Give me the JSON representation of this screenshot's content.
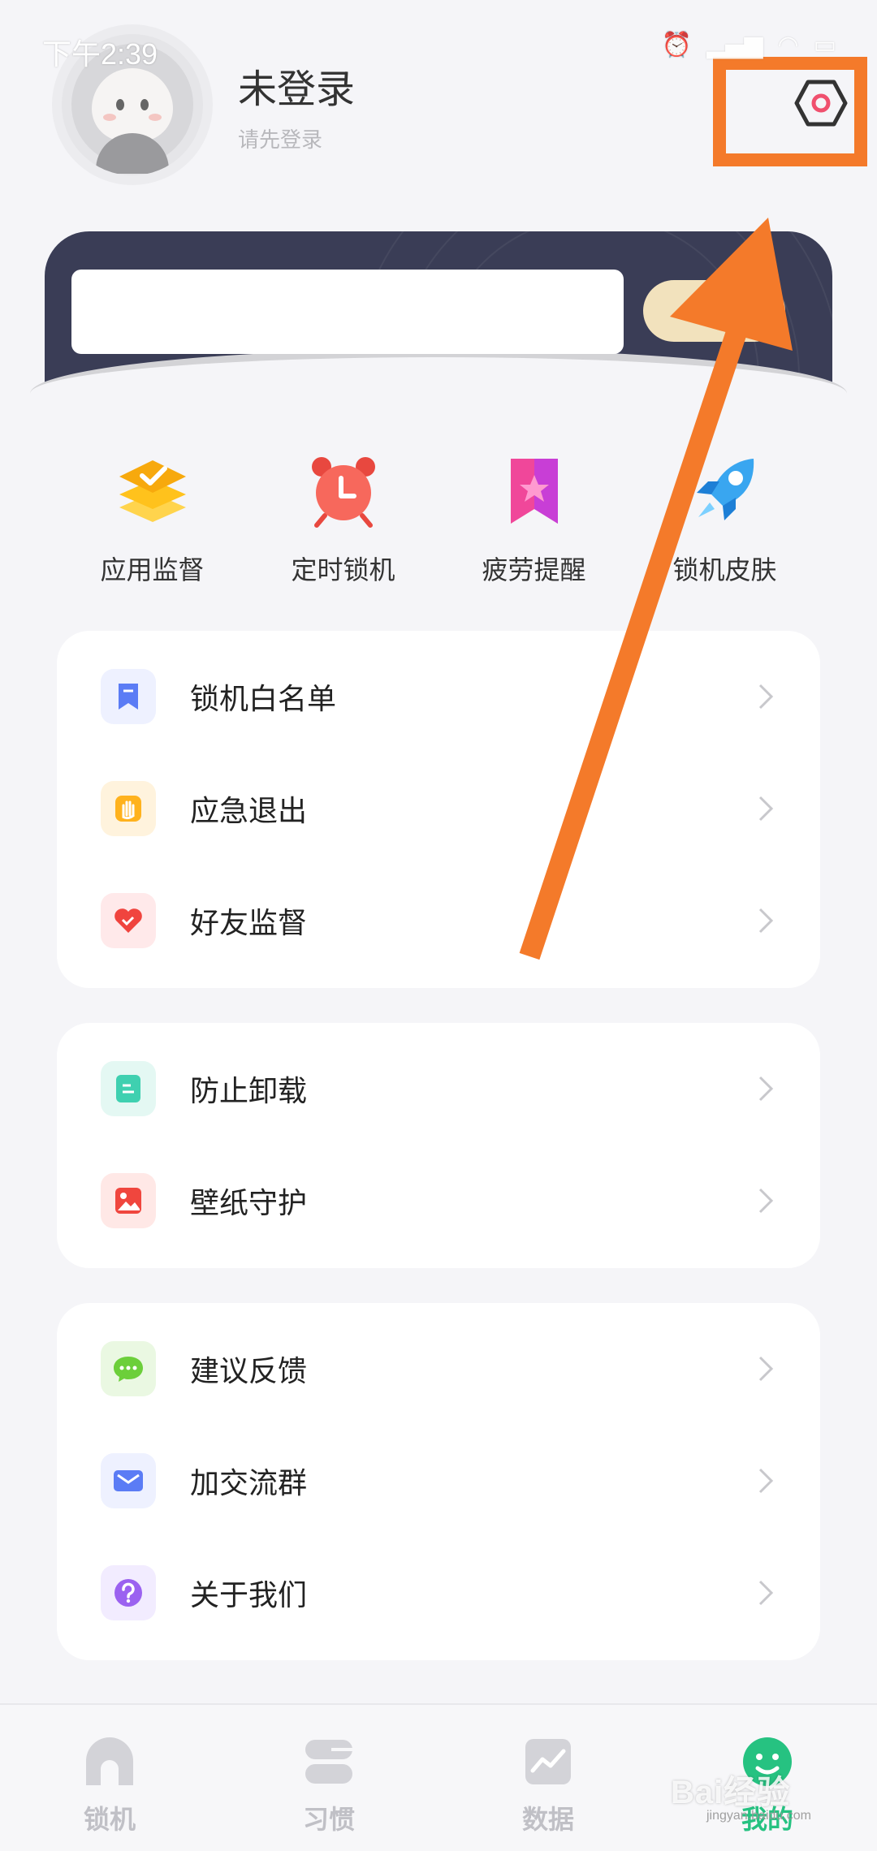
{
  "status_bar": {
    "time": "下午2:39"
  },
  "profile": {
    "username": "未登录",
    "login_hint": "请先登录"
  },
  "shortcuts": [
    {
      "label": "应用监督",
      "icon": "layers-check-icon"
    },
    {
      "label": "定时锁机",
      "icon": "alarm-clock-icon"
    },
    {
      "label": "疲劳提醒",
      "icon": "bookmark-star-icon"
    },
    {
      "label": "锁机皮肤",
      "icon": "rocket-icon"
    }
  ],
  "card1": [
    {
      "label": "锁机白名单",
      "icon": "bookmark-icon"
    },
    {
      "label": "应急退出",
      "icon": "hand-icon"
    },
    {
      "label": "好友监督",
      "icon": "heart-icon"
    }
  ],
  "card2": [
    {
      "label": "防止卸载",
      "icon": "document-icon"
    },
    {
      "label": "壁纸守护",
      "icon": "image-icon"
    }
  ],
  "card3": [
    {
      "label": "建议反馈",
      "icon": "chat-icon"
    },
    {
      "label": "加交流群",
      "icon": "mail-icon"
    },
    {
      "label": "关于我们",
      "icon": "question-icon"
    }
  ],
  "bottom_nav": [
    {
      "label": "锁机",
      "icon": "lock-nav-icon",
      "active": false
    },
    {
      "label": "习惯",
      "icon": "habit-nav-icon",
      "active": false
    },
    {
      "label": "数据",
      "icon": "chart-nav-icon",
      "active": false
    },
    {
      "label": "我的",
      "icon": "profile-nav-icon",
      "active": true
    }
  ],
  "watermark": {
    "brand": "Bai经验",
    "url": "jingyan.baidu.com"
  },
  "colors": {
    "accent": "#26c281",
    "annotation": "#f47a2a",
    "banner": "#3a3d56"
  }
}
